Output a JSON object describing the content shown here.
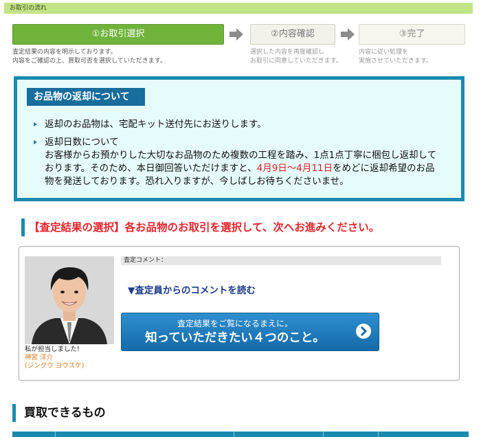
{
  "header": {
    "title": "お取引の流れ"
  },
  "steps": [
    {
      "label": "①お取引選択",
      "desc": "査定結果の内容を明示しております。\n内容をご確認の上、買取可否を選択していただきます。"
    },
    {
      "label": "②内容確認",
      "desc": "選択した内容を再度確認し\nお取引に同意していただきます。"
    },
    {
      "label": "③完了",
      "desc": "内容に従い処理を\n実施させていただきます。"
    }
  ],
  "notice": {
    "title": "お品物の返却について",
    "bullet1": "返却のお品物は、宅配キット送付先にお送りします。",
    "bullet2_head": "返却日数について",
    "bullet2_body_a": "お客様からお預かりした大切なお品物のため複数の工程を踏み、1点1点丁寧に梱包し返却しております。そのため、本日御回答いただけますと、",
    "bullet2_dates": "4月9日〜4月11日",
    "bullet2_body_b": "をめどに返却希望のお品物を発送しております。恐れ入りますが、今しばしお待ちくださいませ。"
  },
  "selection": {
    "heading": "【査定結果の選択】各お品物のお取引を選択して、次へお進みください。"
  },
  "assessor": {
    "caption1": "私が担当しました!",
    "name": "神宮 洋介",
    "reading": "(ジングウ ヨウスケ)",
    "comment_label": "査定コメント：",
    "comment_link": "▼査定員からのコメントを読む",
    "banner_line1": "査定結果をご覧になるまえに。",
    "banner_line2": "知っていただきたい４つのこと。"
  },
  "buyable": {
    "heading": "買取できるもの"
  },
  "colors": {
    "accent": "#1a8ab0",
    "green": "#6fb33a",
    "red": "#e8262e"
  }
}
